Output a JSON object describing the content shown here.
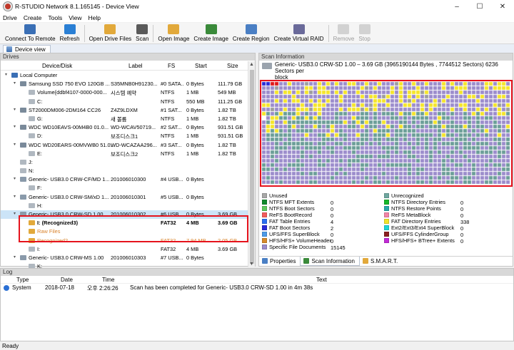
{
  "window": {
    "title": "R-STUDIO Network 8.1.165145 - Device View",
    "minimize": "–",
    "maximize": "☐",
    "close": "✕"
  },
  "menu": [
    "Drive",
    "Create",
    "Tools",
    "View",
    "Help"
  ],
  "toolbar": [
    {
      "label": "Connect To Remote",
      "icon": "connect-remote-icon",
      "color": "#3a6fb5"
    },
    {
      "label": "Refresh",
      "icon": "refresh-icon",
      "color": "#2a7fd4"
    },
    {
      "label": "Open Drive Files",
      "icon": "open-drive-files-icon",
      "color": "#e2a93b"
    },
    {
      "label": "Scan",
      "icon": "scan-icon",
      "color": "#5a5a5a"
    },
    {
      "label": "Open Image",
      "icon": "open-image-icon",
      "color": "#e2a93b"
    },
    {
      "label": "Create Image",
      "icon": "create-image-icon",
      "color": "#3a8a3a"
    },
    {
      "label": "Create Region",
      "icon": "create-region-icon",
      "color": "#4a7fc4"
    },
    {
      "label": "Create Virtual RAID",
      "icon": "create-raid-icon",
      "color": "#6a6a9a"
    },
    {
      "label": "Remove",
      "icon": "remove-icon",
      "color": "#b0b0b0",
      "disabled": true
    },
    {
      "label": "Stop",
      "icon": "stop-icon",
      "color": "#b0b0b0",
      "disabled": true
    }
  ],
  "tab": {
    "label": "Device view"
  },
  "drives": {
    "title": "Drives",
    "columns": {
      "device": "Device/Disk",
      "label": "Label",
      "fs": "FS",
      "start": "Start",
      "size": "Size"
    },
    "rows": [
      {
        "level": 0,
        "exp": "▾",
        "icon": "computer",
        "device": "Local Computer",
        "label": "",
        "fs": "",
        "start": "",
        "size": ""
      },
      {
        "level": 1,
        "exp": "▾",
        "icon": "hdd",
        "device": "Samsung SSD 750 EVO 120GB ...",
        "label": "S35MNB0H91230...",
        "fs": "#0 SATA...",
        "start": "0 Bytes",
        "size": "111.79 GB"
      },
      {
        "level": 2,
        "exp": "",
        "icon": "part",
        "device": "Volume{ddbf4107-0000-000...",
        "label": "시스템 예약",
        "fs": "NTFS",
        "start": "1 MB",
        "size": "549 MB"
      },
      {
        "level": 2,
        "exp": "",
        "icon": "part",
        "device": "C:",
        "label": "",
        "fs": "NTFS",
        "start": "550 MB",
        "size": "111.25 GB"
      },
      {
        "level": 1,
        "exp": "▾",
        "icon": "hdd",
        "device": "ST2000DM006-2DM164 CC26",
        "label": "Z4Z9LDXM",
        "fs": "#1 SAT...",
        "start": "0 Bytes",
        "size": "1.82 TB"
      },
      {
        "level": 2,
        "exp": "",
        "icon": "part",
        "device": "G:",
        "label": "새 볼륨",
        "fs": "NTFS",
        "start": "1 MB",
        "size": "1.82 TB"
      },
      {
        "level": 1,
        "exp": "▾",
        "icon": "hdd",
        "device": "WDC WD10EAVS-00M4B0 01.0...",
        "label": "WD-WCAV50719...",
        "fs": "#2 SAT...",
        "start": "0 Bytes",
        "size": "931.51 GB"
      },
      {
        "level": 2,
        "exp": "",
        "icon": "part",
        "device": "D:",
        "label": "보조디스크1",
        "fs": "NTFS",
        "start": "1 MB",
        "size": "931.51 GB"
      },
      {
        "level": 1,
        "exp": "▾",
        "icon": "hdd",
        "device": "WDC WD20EARS-00MVWB0 51.0...",
        "label": "WD-WCAZAA296...",
        "fs": "#3 SAT...",
        "start": "0 Bytes",
        "size": "1.82 TB"
      },
      {
        "level": 2,
        "exp": "",
        "icon": "part",
        "device": "E:",
        "label": "보조디스크2",
        "fs": "NTFS",
        "start": "1 MB",
        "size": "1.82 TB"
      },
      {
        "level": 1,
        "exp": "",
        "icon": "part",
        "device": "J:",
        "label": "",
        "fs": "",
        "start": "",
        "size": ""
      },
      {
        "level": 1,
        "exp": "",
        "icon": "part",
        "device": "N:",
        "label": "",
        "fs": "",
        "start": "",
        "size": ""
      },
      {
        "level": 1,
        "exp": "▾",
        "icon": "usb",
        "device": "Generic- USB3.0 CRW-CF/MD 1...",
        "label": "201006010300",
        "fs": "#4 USB...",
        "start": "0 Bytes",
        "size": ""
      },
      {
        "level": 2,
        "exp": "",
        "icon": "part",
        "device": "F:",
        "label": "",
        "fs": "",
        "start": "",
        "size": ""
      },
      {
        "level": 1,
        "exp": "▾",
        "icon": "usb",
        "device": "Generic- USB3.0 CRW-SM/xD 1...",
        "label": "201006010301",
        "fs": "#5 USB...",
        "start": "0 Bytes",
        "size": ""
      },
      {
        "level": 2,
        "exp": "",
        "icon": "part",
        "device": "H:",
        "label": "",
        "fs": "",
        "start": "",
        "size": ""
      },
      {
        "level": 1,
        "exp": "▾",
        "icon": "usb",
        "device": "Generic- USB3.0 CRW-SD 1.00",
        "label": "201006010302",
        "fs": "#6 USB...",
        "start": "0 Bytes",
        "size": "3.69 GB",
        "selected": true
      },
      {
        "level": 2,
        "exp": "",
        "icon": "recog",
        "device": "I: (Recognized3)",
        "label": "",
        "fs": "FAT32",
        "start": "4 MB",
        "size": "3.69 GB",
        "bold": true
      },
      {
        "level": 2,
        "exp": "",
        "icon": "raw",
        "device": "Raw Files",
        "label": "",
        "fs": "",
        "start": "",
        "size": "",
        "orange": true
      },
      {
        "level": 2,
        "exp": "",
        "icon": "recog2",
        "device": "Recognized2",
        "label": "",
        "fs": "FAT32",
        "start": "7.94 MB",
        "size": "2.05 GB",
        "orange": true
      },
      {
        "level": 2,
        "exp": "",
        "icon": "part",
        "device": "I:",
        "label": "",
        "fs": "FAT32",
        "start": "4 MB",
        "size": "3.69 GB"
      },
      {
        "level": 1,
        "exp": "▾",
        "icon": "usb",
        "device": "Generic- USB3.0 CRW-MS 1.00",
        "label": "201006010303",
        "fs": "#7 USB...",
        "start": "0 Bytes",
        "size": ""
      },
      {
        "level": 2,
        "exp": "",
        "icon": "part",
        "device": "K:",
        "label": "",
        "fs": "",
        "start": "",
        "size": ""
      }
    ]
  },
  "scan": {
    "title": "Scan Information",
    "disk_line1": "Generic- USB3.0 CRW-SD 1.00 – 3.69 GB (3965190144 Bytes , 7744512 Sectors) 6236 Sectors per",
    "disk_line2": "block",
    "map_colors": {
      "unused": "#9d9d9d",
      "unrecognized": "#6b9e98",
      "violet": "#9b8ccc",
      "yellow": "#f5e52a",
      "blue": "#2a2ad8",
      "red": "#e01818",
      "empty": "#ffffff"
    },
    "legend": [
      {
        "name": "Unused",
        "color": "#a8a8a8",
        "value": ""
      },
      {
        "name": "Unrecognized",
        "color": "#6fa8a0",
        "value": ""
      },
      {
        "name": "NTFS MFT Extents",
        "color": "#0f8a2c",
        "value": "0"
      },
      {
        "name": "NTFS Directory Entries",
        "color": "#16b82a",
        "value": "0"
      },
      {
        "name": "NTFS Boot Sectors",
        "color": "#5dc95d",
        "value": "0"
      },
      {
        "name": "NTFS Restore Points",
        "color": "#2aa8a8",
        "value": "0"
      },
      {
        "name": "ReFS BootRecord",
        "color": "#f25c5c",
        "value": "0"
      },
      {
        "name": "ReFS MetaBlock",
        "color": "#f285a8",
        "value": "0"
      },
      {
        "name": "FAT Table Entries",
        "color": "#2a6ff2",
        "value": "4"
      },
      {
        "name": "FAT Directory Entries",
        "color": "#f2e52a",
        "value": "338"
      },
      {
        "name": "FAT Boot Sectors",
        "color": "#2a2ad8",
        "value": "2"
      },
      {
        "name": "Ext2/Ext3/Ext4 SuperBlock",
        "color": "#1fd6d6",
        "value": "0"
      },
      {
        "name": "UFS/FFS SuperBlock",
        "color": "#4d9be8",
        "value": "0"
      },
      {
        "name": "UFS/FFS CylinderGroup",
        "color": "#8a1f1f",
        "value": "0"
      },
      {
        "name": "HFS/HFS+ VolumeHeader",
        "color": "#d68a2a",
        "value": "0"
      },
      {
        "name": "HFS/HFS+ BTree+ Extents",
        "color": "#c22ad6",
        "value": "0"
      },
      {
        "name": "Specific File Documents",
        "color": "#9b8ccc",
        "value": "15145"
      }
    ],
    "tabs": [
      {
        "label": "Properties",
        "icon": "properties-icon",
        "color": "#4a7fc4"
      },
      {
        "label": "Scan Information",
        "icon": "scan-information-icon",
        "color": "#3a8a3a",
        "active": true
      },
      {
        "label": "S.M.A.R.T.",
        "icon": "smart-icon",
        "color": "#e2a93b"
      }
    ]
  },
  "log": {
    "title": "Log",
    "columns": {
      "type": "Type",
      "date": "Date",
      "time": "Time",
      "text": "Text"
    },
    "rows": [
      {
        "type": "System",
        "date": "2018-07-18",
        "time": "오후 2:26:26",
        "text": "Scan has been completed for Generic- USB3.0 CRW-SD 1.00 in 4m 38s"
      }
    ]
  },
  "status": "Ready"
}
